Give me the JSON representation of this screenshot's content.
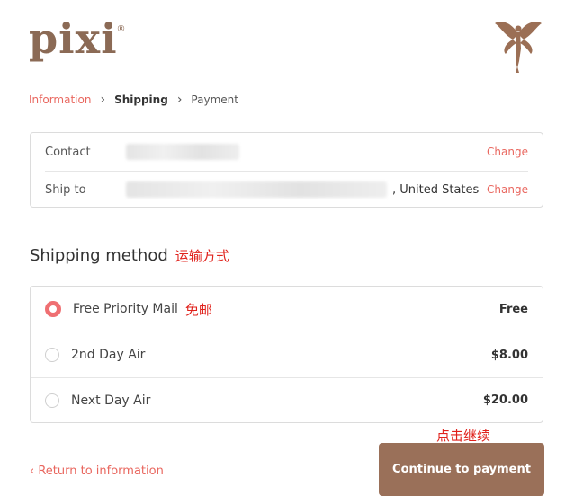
{
  "brand": {
    "logo_text": "pixi",
    "reg_mark": "®"
  },
  "breadcrumb": {
    "items": [
      "Information",
      "Shipping",
      "Payment"
    ],
    "separator": "›"
  },
  "review": {
    "contact_label": "Contact",
    "ship_to_label": "Ship to",
    "ship_to_country": ", United States",
    "change_label": "Change"
  },
  "shipping": {
    "title": "Shipping method",
    "annotation": "运输方式",
    "methods": [
      {
        "label": "Free Priority Mail",
        "annotation": "免邮",
        "price": "Free",
        "selected": true
      },
      {
        "label": "2nd Day Air",
        "price": "$8.00",
        "selected": false
      },
      {
        "label": "Next Day Air",
        "price": "$20.00",
        "selected": false
      }
    ]
  },
  "footer": {
    "return_link": "‹ Return to information",
    "continue_button": "Continue to payment",
    "continue_annotation": "点击继续"
  },
  "colors": {
    "accent": "#e9675f",
    "button": "#9a7059",
    "brand": "#8b6a55",
    "annotation": "#e0211b"
  }
}
